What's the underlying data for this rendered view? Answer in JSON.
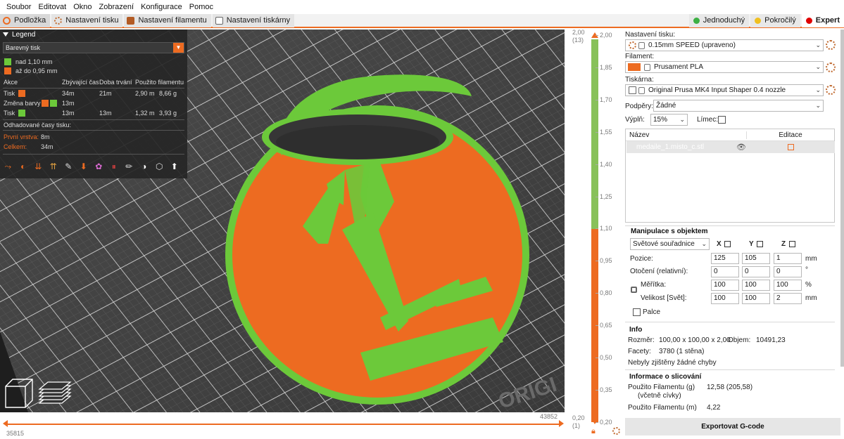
{
  "menu": [
    "Soubor",
    "Editovat",
    "Okno",
    "Zobrazení",
    "Konfigurace",
    "Pomoc"
  ],
  "tabs": [
    {
      "label": "Podložka",
      "icon": "bed-icon"
    },
    {
      "label": "Nastavení tisku",
      "icon": "gear-icon"
    },
    {
      "label": "Nastavení filamentu",
      "icon": "filament-icon"
    },
    {
      "label": "Nastavení tiskárny",
      "icon": "printer-icon"
    }
  ],
  "modes": [
    {
      "label": "Jednoduchý",
      "color": "#3cb043"
    },
    {
      "label": "Pokročilý",
      "color": "#f0c020"
    },
    {
      "label": "Expert",
      "color": "#e00000"
    }
  ],
  "legend": {
    "title": "Legend",
    "view_type": "Barevný tisk",
    "colors": [
      {
        "label": "nad 1,10 mm",
        "color": "#6cc93a"
      },
      {
        "label": "až do 0,95 mm",
        "color": "#ed6b21"
      }
    ],
    "table_headers": [
      "Akce",
      "Zbývající čas",
      "Doba trvání",
      "Použito filamentu"
    ],
    "rows": [
      {
        "action": "Tisk",
        "remaining": "34m",
        "duration": "21m",
        "length": "2,90 m",
        "weight": "8,66 g"
      },
      {
        "action": "Změna barvy",
        "remaining": "13m",
        "duration": "",
        "length": "",
        "weight": ""
      },
      {
        "action": "Tisk",
        "remaining": "13m",
        "duration": "13m",
        "length": "1,32 m",
        "weight": "3,93 g"
      }
    ],
    "estimated_title": "Odhadované časy tisku:",
    "first_layer_label": "První vrstva:",
    "first_layer_value": "8m",
    "total_label": "Celkem:",
    "total_value": "34m"
  },
  "hslider": {
    "left_value": "35815",
    "right_value": "43852"
  },
  "vslider": {
    "top_left": "2,00",
    "top_left_count": "(13)",
    "bottom_left": "0,20",
    "bottom_left_count": "(1)",
    "ticks": [
      "2,00",
      "1,85",
      "1,70",
      "1,55",
      "1,40",
      "1,25",
      "1,10",
      "0,95",
      "0,80",
      "0,65",
      "0,50",
      "0,35",
      "0,20"
    ]
  },
  "panel": {
    "print_label": "Nastavení tisku:",
    "print_value": "0.15mm SPEED (upraveno)",
    "filament_label": "Filament:",
    "filament_value": "Prusament PLA",
    "filament_color": "#ed6b21",
    "printer_label": "Tiskárna:",
    "printer_value": "Original Prusa MK4 Input Shaper 0.4 nozzle",
    "supports_label": "Podpěry:",
    "supports_value": "Žádné",
    "infill_label": "Výplň:",
    "infill_value": "15%",
    "brim_label": "Límec:",
    "list_col_name": "Název",
    "list_col_edit": "Editace",
    "object_name": "medaile_1.misto_c.stl",
    "manip_title": "Manipulace s objektem",
    "coord_value": "Světové souřadnice",
    "axis_x": "X",
    "axis_y": "Y",
    "axis_z": "Z",
    "pos_label": "Pozice:",
    "pos": [
      "125",
      "105",
      "1"
    ],
    "rot_label": "Otočení (relativní):",
    "rot": [
      "0",
      "0",
      "0"
    ],
    "scale_label": "Měřítka:",
    "scale": [
      "100",
      "100",
      "100"
    ],
    "size_label": "Velikost [Svět]:",
    "size": [
      "100",
      "100",
      "2"
    ],
    "unit_mm": "mm",
    "unit_deg": "°",
    "unit_pct": "%",
    "inches_label": "Palce",
    "info_title": "Info",
    "size_info_label": "Rozměr:",
    "size_info_value": "100,00 x 100,00 x 2,00",
    "volume_label": "Objem:",
    "volume_value": "10491,23",
    "facets_label": "Facety:",
    "facets_value": "3780 (1 stěna)",
    "errors_text": "Nebyly zjištěny žádné chyby",
    "slice_title": "Informace o slicování",
    "fil_g_label": "Použito Filamentu (g)",
    "fil_g_sub": "(včetně cívky)",
    "fil_g_value": "12,58 (205,58)",
    "fil_m_label": "Použito Filamentu (m)",
    "fil_m_value": "4,22",
    "export_label": "Exportovat G-code"
  },
  "viewport_text": "ORIGI"
}
